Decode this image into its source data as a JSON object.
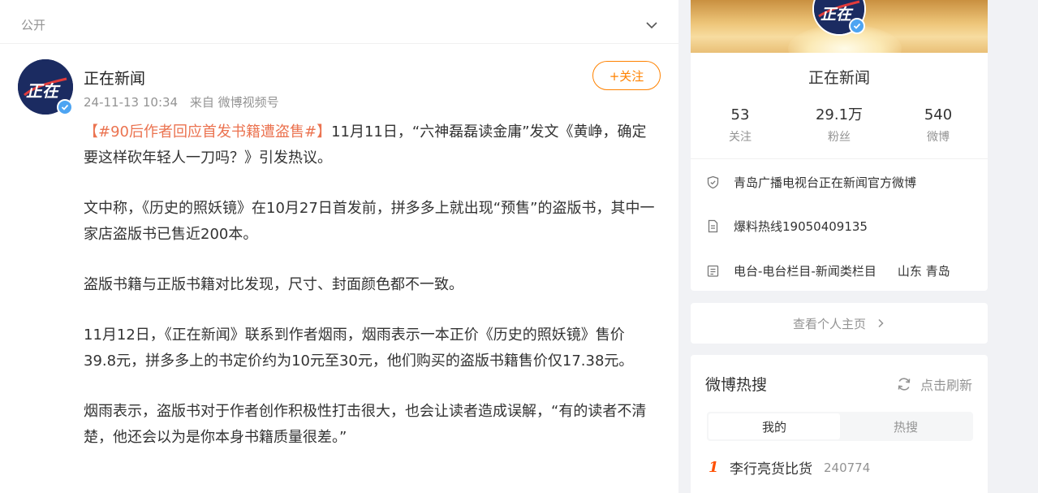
{
  "feed": {
    "visibility": "公开",
    "author": {
      "name": "正在新闻",
      "avatar_text": "正在",
      "timestamp": "24-11-13 10:34",
      "source": "来自 微博视频号"
    },
    "follow_label": "+关注",
    "post": {
      "hashtag": "【#90后作者回应首发书籍遭盗售#】",
      "p1_rest": "11月11日，“六神磊磊读金庸”发文《黄峥，确定要这样砍年轻人一刀吗？》引发热议。",
      "p2": "文中称，《历史的照妖镜》在10月27日首发前，拼多多上就出现“预售”的盗版书，其中一家店盗版书已售近200本。",
      "p3": "盗版书籍与正版书籍对比发现，尺寸、封面颜色都不一致。",
      "p4": "11月12日，《正在新闻》联系到作者烟雨，烟雨表示一本正价《历史的照妖镜》售价39.8元，拼多多上的书定价约为10元至30元，他们购买的盗版书籍售价仅17.38元。",
      "p5": "烟雨表示，盗版书对于作者创作积极性打击很大，也会让读者造成误解，“有的读者不清楚，他还会以为是你本身书籍质量很差。”"
    }
  },
  "profile": {
    "name": "正在新闻",
    "stats": [
      {
        "num": "53",
        "label": "关注"
      },
      {
        "num": "29.1万",
        "label": "粉丝"
      },
      {
        "num": "540",
        "label": "微博"
      }
    ],
    "info": [
      {
        "icon": "verified-shield-icon",
        "text": "青岛广播电视台正在新闻官方微博",
        "extra": ""
      },
      {
        "icon": "document-icon",
        "text": "爆料热线19050409135",
        "extra": ""
      },
      {
        "icon": "category-icon",
        "text": "电台-电台栏目-新闻类栏目",
        "extra": "山东 青岛"
      }
    ],
    "homepage_label": "查看个人主页"
  },
  "hot_search": {
    "title": "微博热搜",
    "refresh_label": "点击刷新",
    "tabs": [
      "我的",
      "热搜"
    ],
    "active_tab": "我的",
    "items": [
      {
        "rank": "1",
        "word": "李行亮货比货",
        "count": "240774"
      }
    ]
  },
  "colors": {
    "accent": "#ff8200",
    "hashtag": "#eb7350",
    "verified": "#4da4f2",
    "rank": "#ff5000"
  }
}
